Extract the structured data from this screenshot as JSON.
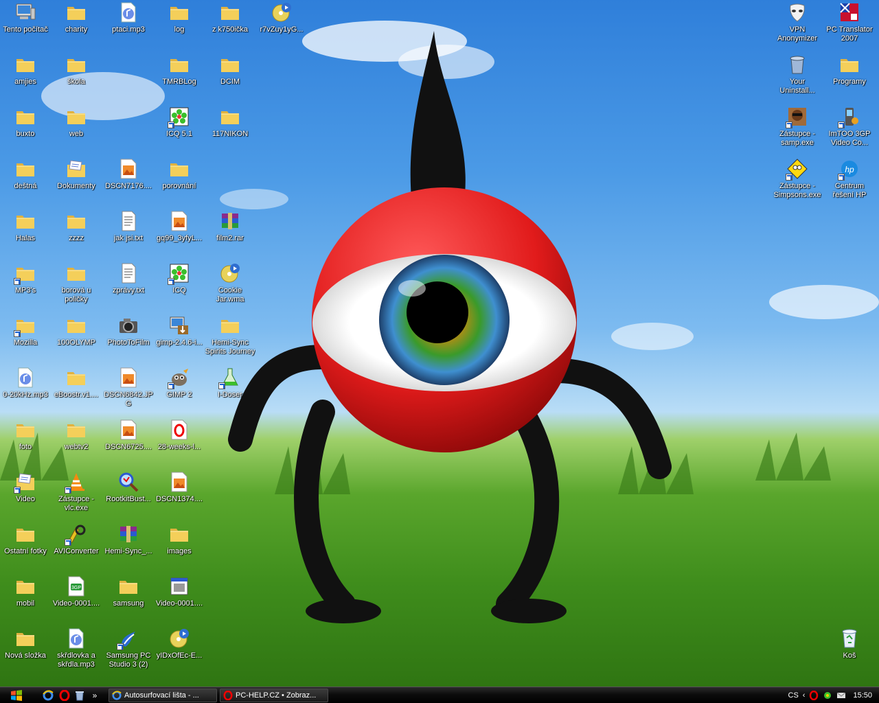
{
  "desktop": {
    "icons_left": [
      {
        "label": "Tento počítač",
        "type": "computer",
        "shortcut": false
      },
      {
        "label": "charity",
        "type": "folder",
        "shortcut": false
      },
      {
        "label": "ptaci.mp3",
        "type": "audio",
        "shortcut": false
      },
      {
        "label": "log",
        "type": "folder",
        "shortcut": false
      },
      {
        "label": "z k750ička",
        "type": "folder",
        "shortcut": false
      },
      {
        "label": "r7vZuy1yG...",
        "type": "media",
        "shortcut": false
      },
      {
        "label": "amjies",
        "type": "folder",
        "shortcut": false
      },
      {
        "label": "škola",
        "type": "folder",
        "shortcut": false
      },
      {
        "label": "TMRBLog",
        "type": "folder",
        "shortcut": false
      },
      {
        "label": "DCIM",
        "type": "folder",
        "shortcut": false
      },
      {
        "label": "buxto",
        "type": "folder",
        "shortcut": false
      },
      {
        "label": "web",
        "type": "folder",
        "shortcut": false
      },
      {
        "label": "ICQ 5.1",
        "type": "icq",
        "shortcut": true
      },
      {
        "label": "117NIKON",
        "type": "folder",
        "shortcut": false
      },
      {
        "label": "deštná",
        "type": "folder",
        "shortcut": false
      },
      {
        "label": "Dokumenty",
        "type": "documents",
        "shortcut": false
      },
      {
        "label": "DSCN7176....",
        "type": "image",
        "shortcut": false
      },
      {
        "label": "porovnání",
        "type": "folder",
        "shortcut": false
      },
      {
        "label": "Halas",
        "type": "folder",
        "shortcut": false
      },
      {
        "label": "zzzz",
        "type": "folder",
        "shortcut": false
      },
      {
        "label": "jak jsi.txt",
        "type": "text",
        "shortcut": false
      },
      {
        "label": "gq99_3yfyL...",
        "type": "image",
        "shortcut": false
      },
      {
        "label": "film2.rar",
        "type": "rar",
        "shortcut": false
      },
      {
        "label": "MP3's",
        "type": "folder",
        "shortcut": true
      },
      {
        "label": "borová u poličky",
        "type": "folder",
        "shortcut": false
      },
      {
        "label": "zprávy.txt",
        "type": "text",
        "shortcut": false
      },
      {
        "label": "ICQ",
        "type": "icq",
        "shortcut": true
      },
      {
        "label": "Cookie Jar.wma",
        "type": "media",
        "shortcut": false
      },
      {
        "label": "Mozilla",
        "type": "folder",
        "shortcut": true
      },
      {
        "label": "100OLYMP",
        "type": "folder",
        "shortcut": false
      },
      {
        "label": "PhotoToFilm",
        "type": "camera",
        "shortcut": false
      },
      {
        "label": "gimp-2.4.6-i...",
        "type": "installer",
        "shortcut": false
      },
      {
        "label": "Hemi-Sync Spirits Journey",
        "type": "folder",
        "shortcut": false
      },
      {
        "label": "0-20kHz.mp3",
        "type": "audio",
        "shortcut": false
      },
      {
        "label": "eBoostr.v1....",
        "type": "folder",
        "shortcut": false
      },
      {
        "label": "DSCN6842.JPG",
        "type": "image",
        "shortcut": false
      },
      {
        "label": "GIMP 2",
        "type": "gimp",
        "shortcut": true
      },
      {
        "label": "I-Doser",
        "type": "flask",
        "shortcut": true
      },
      {
        "label": "foto",
        "type": "folder",
        "shortcut": false
      },
      {
        "label": "webtv2",
        "type": "folder",
        "shortcut": false
      },
      {
        "label": "DSCN6725....",
        "type": "image",
        "shortcut": false
      },
      {
        "label": "28-weeks-l...",
        "type": "opera",
        "shortcut": false
      },
      {
        "label": "Video",
        "type": "documents",
        "shortcut": true
      },
      {
        "label": "Zástupce - vlc.exe",
        "type": "vlc",
        "shortcut": true
      },
      {
        "label": "RootkitBust...",
        "type": "magnifier",
        "shortcut": false
      },
      {
        "label": "DSCN1374....",
        "type": "image",
        "shortcut": false
      },
      {
        "label": "Ostatní fotky",
        "type": "folder",
        "shortcut": false
      },
      {
        "label": "AVIConverter",
        "type": "converter",
        "shortcut": true
      },
      {
        "label": "Hemi-Sync_...",
        "type": "rar",
        "shortcut": false
      },
      {
        "label": "images",
        "type": "folder",
        "shortcut": false
      },
      {
        "label": "mobil",
        "type": "folder",
        "shortcut": false
      },
      {
        "label": "Video-0001....",
        "type": "3gp",
        "shortcut": false
      },
      {
        "label": "samsung",
        "type": "folder",
        "shortcut": false
      },
      {
        "label": "Video-0001....",
        "type": "video",
        "shortcut": false
      },
      {
        "label": "Nová složka",
        "type": "folder",
        "shortcut": false
      },
      {
        "label": "skřdlovka a skřdla.mp3",
        "type": "audio",
        "shortcut": false
      },
      {
        "label": "Samsung PC Studio 3 (2)",
        "type": "samsung",
        "shortcut": true
      },
      {
        "label": "yIDxOfEc-E...",
        "type": "media",
        "shortcut": false
      }
    ],
    "icons_right": [
      {
        "label": "VPN Anonymizer",
        "type": "mask",
        "shortcut": false
      },
      {
        "label": "PC Translator 2007",
        "type": "translator",
        "shortcut": false
      },
      {
        "label": "Your Uninstall...",
        "type": "bin",
        "shortcut": false
      },
      {
        "label": "Programy",
        "type": "folder",
        "shortcut": false
      },
      {
        "label": "Zástupce - samp.exe",
        "type": "samp",
        "shortcut": true
      },
      {
        "label": "ImTOO 3GP Video Co...",
        "type": "phone",
        "shortcut": true
      },
      {
        "label": "Zástupce - Simpsons.exe",
        "type": "simpsons",
        "shortcut": true
      },
      {
        "label": "Centrum řešení HP",
        "type": "hp",
        "shortcut": true
      },
      {
        "label": "Koš",
        "type": "recycle",
        "shortcut": false
      }
    ]
  },
  "taskbar": {
    "quicklaunch": [
      "internet-explorer",
      "opera",
      "recycle",
      "overflow"
    ],
    "overflow_glyph": "»",
    "tasks": [
      {
        "label": "Autosurfovací lišta - ...",
        "icon": "internet-explorer"
      },
      {
        "label": "PC-HELP.CZ • Zobraz...",
        "icon": "opera"
      }
    ],
    "tray": {
      "lang": "CS",
      "arrow": "‹",
      "clock": "15:50"
    }
  },
  "colors": {
    "folder": "#f4cf5a",
    "taskbar": "#0c0c0c",
    "sky": "#3a86d8",
    "grass": "#4a9a22",
    "ball": "#e11b1b"
  }
}
